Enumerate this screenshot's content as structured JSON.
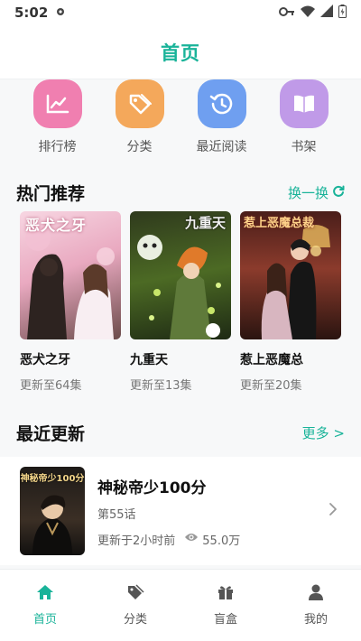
{
  "status_bar": {
    "time": "5:02"
  },
  "header": {
    "title": "首页"
  },
  "quick_nav": [
    {
      "label": "排行榜",
      "icon": "chart-icon",
      "color": "#f07fb0"
    },
    {
      "label": "分类",
      "icon": "tag-icon",
      "color": "#f4a85b"
    },
    {
      "label": "最近阅读",
      "icon": "history-icon",
      "color": "#6f9ff0"
    },
    {
      "label": "书架",
      "icon": "book-icon",
      "color": "#c09ae8"
    }
  ],
  "hot": {
    "title": "热门推荐",
    "action": "换一换",
    "items": [
      {
        "title": "恶犬之牙",
        "sub": "更新至64集",
        "cover_text": "恶犬之牙"
      },
      {
        "title": "九重天",
        "sub": "更新至13集",
        "cover_text": "九重天"
      },
      {
        "title": "惹上恶魔总",
        "sub": "更新至20集",
        "cover_text": "惹上恶魔总裁"
      }
    ]
  },
  "recent": {
    "title": "最近更新",
    "more": "更多 >",
    "item": {
      "title": "神秘帝少100分",
      "episode": "第55话",
      "updated": "更新于2小时前",
      "views": "55.0万",
      "cover_text": "神秘帝少100分"
    }
  },
  "tabbar": [
    {
      "label": "首页",
      "icon": "home-icon",
      "active": true
    },
    {
      "label": "分类",
      "icon": "tag-icon",
      "active": false
    },
    {
      "label": "盲盒",
      "icon": "gift-icon",
      "active": false
    },
    {
      "label": "我的",
      "icon": "user-icon",
      "active": false
    }
  ],
  "colors": {
    "accent": "#19b399"
  }
}
